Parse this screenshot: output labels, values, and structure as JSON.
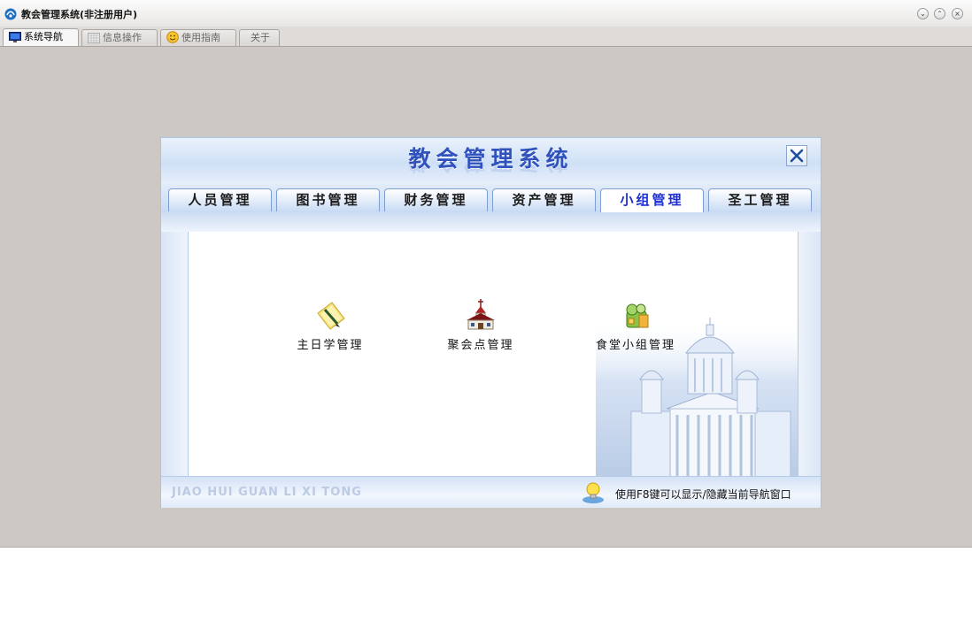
{
  "window": {
    "title": "教会管理系统(非注册用户)",
    "controls": {
      "minimize": "⌄",
      "restore": "⌃",
      "close": "×"
    }
  },
  "app_tabs": [
    {
      "label": "系统导航",
      "icon": "monitor-icon",
      "active": true
    },
    {
      "label": "信息操作",
      "icon": "grid-icon",
      "active": false
    },
    {
      "label": "使用指南",
      "icon": "smiley-icon",
      "active": false
    },
    {
      "label": "关于",
      "icon": "",
      "active": false
    }
  ],
  "navigator": {
    "title": "教会管理系统",
    "tabs": [
      {
        "label": "人员管理",
        "active": false
      },
      {
        "label": "图书管理",
        "active": false
      },
      {
        "label": "财务管理",
        "active": false
      },
      {
        "label": "资产管理",
        "active": false
      },
      {
        "label": "小组管理",
        "active": true
      },
      {
        "label": "圣工管理",
        "active": false
      }
    ],
    "modules": [
      {
        "label": "主日学管理",
        "icon": "notepad-pencil-icon"
      },
      {
        "label": "聚会点管理",
        "icon": "church-icon"
      },
      {
        "label": "食堂小组管理",
        "icon": "food-basket-icon"
      }
    ],
    "footer": {
      "pinyin": "JIAO HUI GUAN LI XI TONG",
      "hint": "使用F8键可以显示/隐藏当前导航窗口"
    }
  },
  "colors": {
    "accent": "#2f52bd",
    "active_tab_text": "#1c2fd3",
    "panel_border": "#a9c3e6",
    "app_background": "#cdc8c4"
  }
}
